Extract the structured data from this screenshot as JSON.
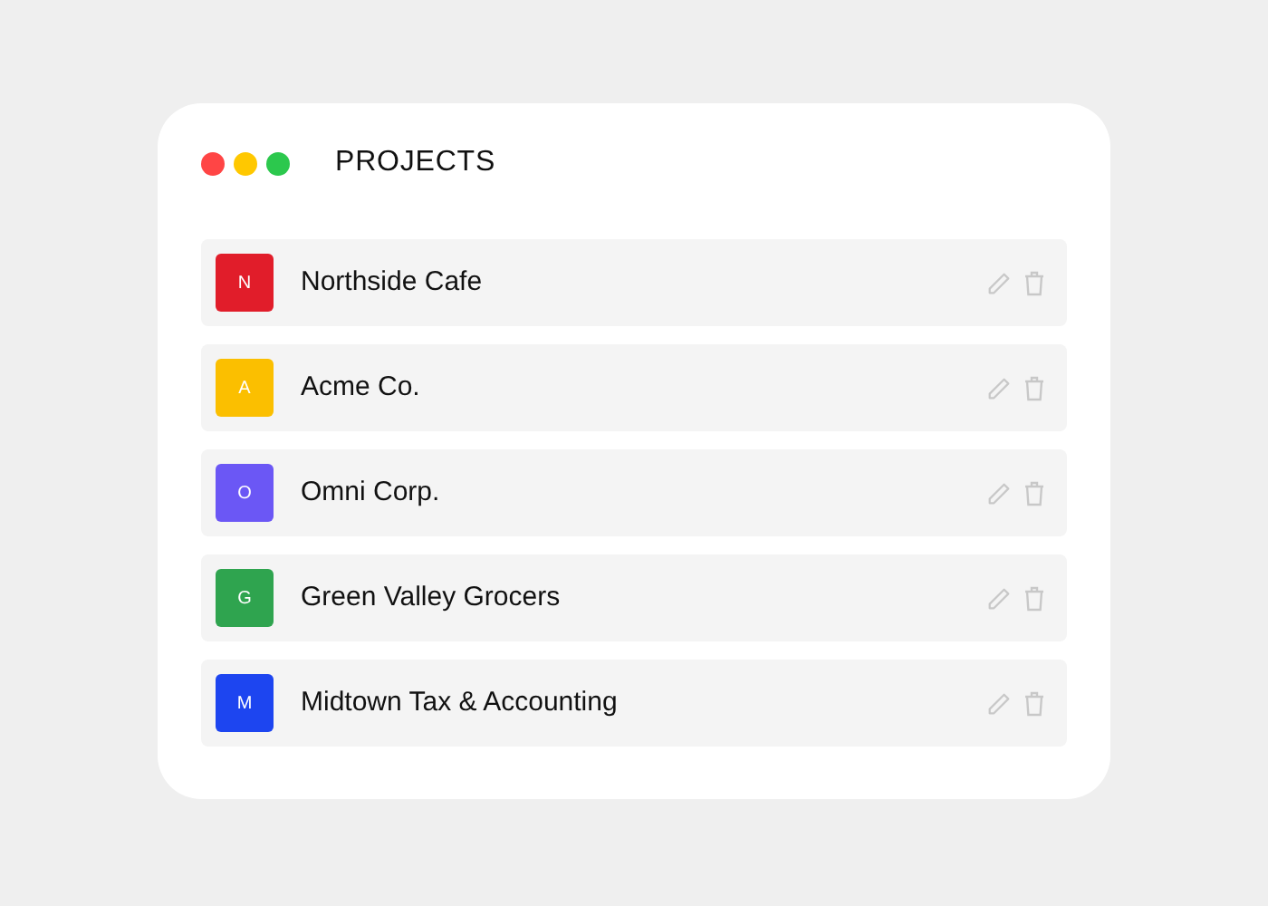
{
  "title": "PROJECTS",
  "projects": [
    {
      "initial": "N",
      "name": "Northside Cafe",
      "color": "#e11d2a"
    },
    {
      "initial": "A",
      "name": "Acme Co.",
      "color": "#fbbf00"
    },
    {
      "initial": "O",
      "name": "Omni Corp.",
      "color": "#6b57f5"
    },
    {
      "initial": "G",
      "name": "Green Valley Grocers",
      "color": "#2fa44f"
    },
    {
      "initial": "M",
      "name": "Midtown Tax & Accounting",
      "color": "#1d45f0"
    }
  ]
}
